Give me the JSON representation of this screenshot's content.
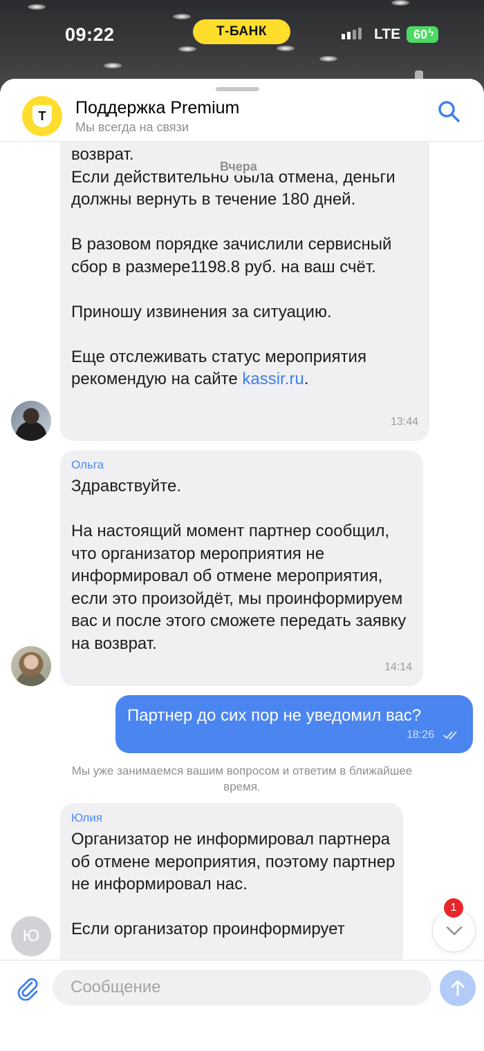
{
  "status_bar": {
    "time": "09:22",
    "carrier_badge": "Т-БАНК",
    "network": "LTE",
    "battery": "60"
  },
  "header": {
    "avatar_letter": "Т",
    "title": "Поддержка Premium",
    "subtitle": "Мы всегда на связи"
  },
  "date_separator": "Вчера",
  "messages": [
    {
      "direction": "incoming",
      "text": "возврат.\nЕсли действительно была отмена, деньги должны вернуть в течение 180 дней.\n\nВ разовом порядке зачислили сервисный сбор в размере1198.8 руб. на ваш счёт.\n\nПриношу извинения за ситуацию.\n\nЕще отслеживать статус мероприятия рекомендую на сайте ",
      "link": "kassir.ru",
      "text_after_link": ".",
      "time": "13:44"
    },
    {
      "direction": "incoming",
      "sender": "Ольга",
      "text": "Здравствуйте.\n\nНа настоящий момент партнер сообщил, что организатор мероприятия не информировал об отмене мероприятия, если это произойдёт, мы проинформируем вас и после этого сможете передать заявку на возврат.",
      "time": "14:14"
    },
    {
      "direction": "outgoing",
      "text": "Партнер до сих пор не уведомил вас?",
      "time": "18:26"
    },
    {
      "direction": "incoming",
      "sender": "Юлия",
      "avatar_letter": "Ю",
      "text": "Организатор не информировал партнера об отмене мероприятия, поэтому партнер не информировал нас.\n\nЕсли организатор проинформирует"
    }
  ],
  "system_note": "Мы уже занимаемся вашим вопросом и ответим в ближайшее время.",
  "unread_count": "1",
  "composer": {
    "placeholder": "Сообщение"
  },
  "colors": {
    "accent": "#4b85f0",
    "brand_yellow": "#ffdd2d",
    "incoming_bubble": "#f0f0f2"
  }
}
